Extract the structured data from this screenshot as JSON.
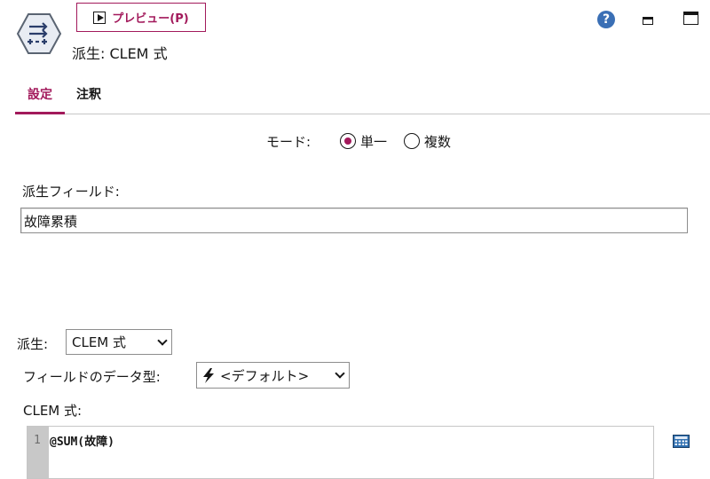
{
  "header": {
    "preview_label": "プレビュー(P)",
    "node_title": "派生: CLEM 式",
    "help_icon": "question-circle-icon",
    "minimize_icon": "minimize-icon",
    "maximize_icon": "maximize-icon",
    "help_symbol": "?"
  },
  "tabs": [
    {
      "label": "設定",
      "active": true
    },
    {
      "label": "注釈",
      "active": false
    }
  ],
  "mode": {
    "label": "モード:",
    "options": [
      {
        "label": "単一",
        "selected": true
      },
      {
        "label": "複数",
        "selected": false
      }
    ]
  },
  "derive_field": {
    "label": "派生フィールド:",
    "value": "故障累積"
  },
  "derive_as": {
    "label": "派生:",
    "selected": "CLEM 式"
  },
  "field_type": {
    "label": "フィールドのデータ型:",
    "selected": "<デフォルト>",
    "icon": "lightning-bolt-icon"
  },
  "clem": {
    "label": "CLEM 式:",
    "line_number": "1",
    "expression": "@SUM(故障)"
  },
  "colors": {
    "accent": "#a2195b",
    "help_blue": "#3a6fb5"
  }
}
